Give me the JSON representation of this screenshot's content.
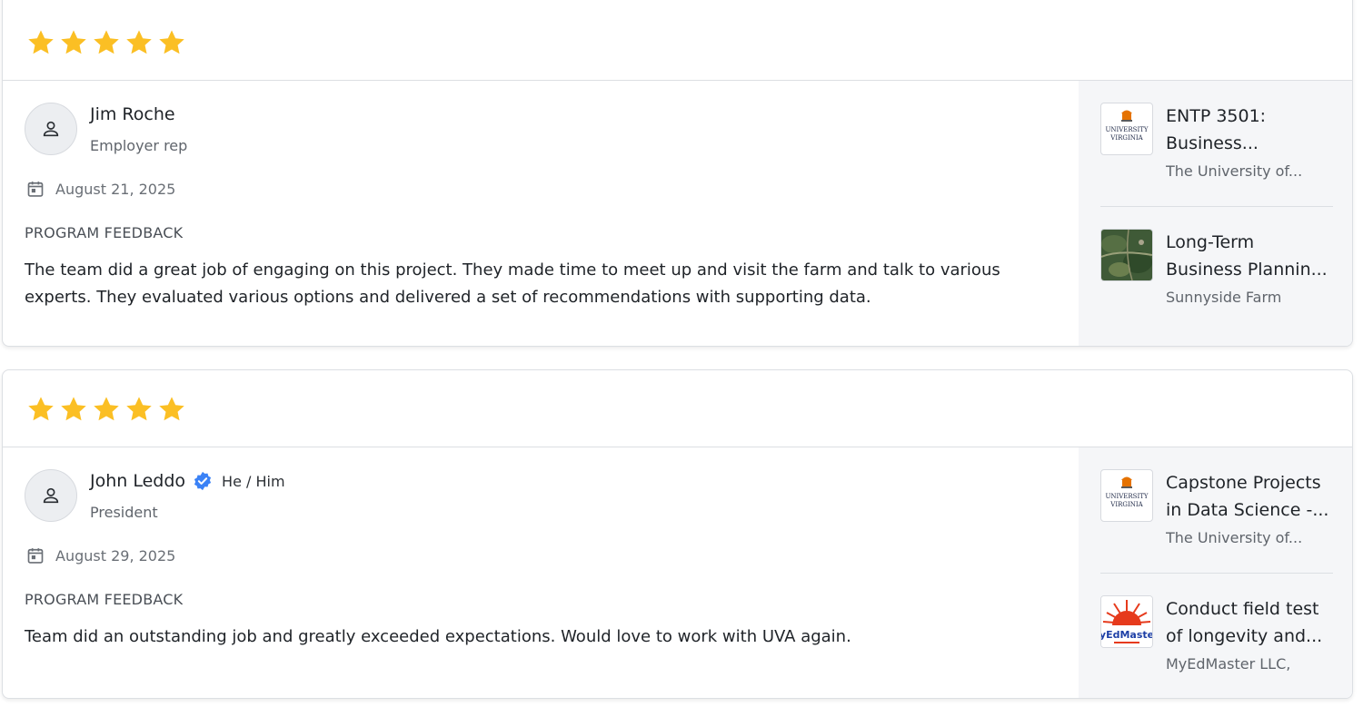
{
  "colors": {
    "star": "#FBBF24",
    "verified": "#3B82F6"
  },
  "reviews": [
    {
      "rating": 5,
      "name": "Jim Roche",
      "pronouns": "",
      "role": "Employer rep",
      "date": "August 21, 2025",
      "section_label": "PROGRAM FEEDBACK",
      "feedback": "The team did a great job of engaging on this project. They made time to meet up and visit the farm and talk to various experts. They evaluated various options and delivered a set of recommendations with supporting data.",
      "projects": [
        {
          "title_line1": "ENTP 3501:",
          "title_line2": "Business...",
          "org": "The University of...",
          "logo": "uva-logo"
        },
        {
          "title_line1": "Long-Term",
          "title_line2": "Business Plannin...",
          "org": "Sunnyside Farm",
          "logo": "satellite-map-thumbnail"
        }
      ]
    },
    {
      "rating": 5,
      "name": "John Leddo",
      "pronouns": "He / Him",
      "role": "President",
      "date": "August 29, 2025",
      "section_label": "PROGRAM FEEDBACK",
      "feedback": "Team did an outstanding job and greatly exceeded expectations. Would love to work with UVA again.",
      "projects": [
        {
          "title_line1": "Capstone Projects",
          "title_line2": "in Data Science -...",
          "org": "The University of...",
          "logo": "uva-logo"
        },
        {
          "title_line1": "Conduct field test",
          "title_line2": "of longevity and...",
          "org": "MyEdMaster LLC,",
          "logo": "myedmaster-logo",
          "logo_text": "yEdMaste"
        }
      ]
    }
  ]
}
